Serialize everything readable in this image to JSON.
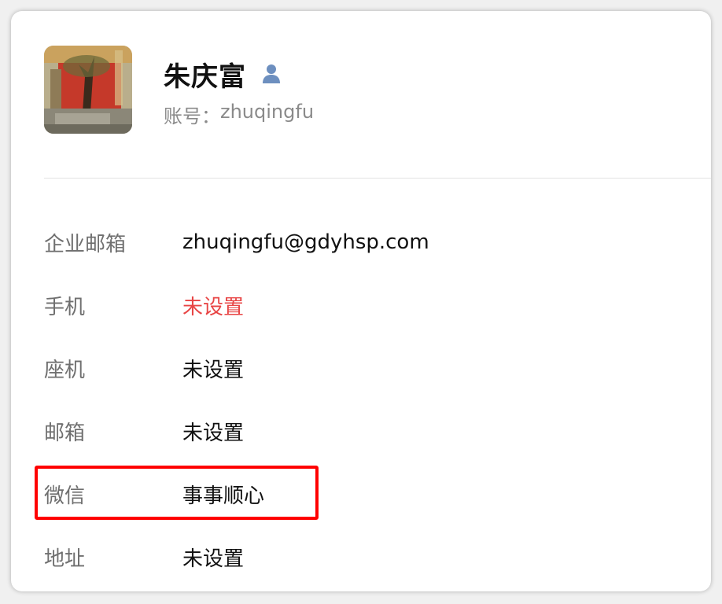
{
  "profile": {
    "name": "朱庆富",
    "account_label": "账号：",
    "account_value": "zhuqingfu",
    "avatar_icon": "avatar-photo",
    "user_icon": "person-icon"
  },
  "fields": [
    {
      "label": "企业邮箱",
      "value": "zhuqingfu@gdyhsp.com"
    },
    {
      "label": "手机",
      "value": "未设置"
    },
    {
      "label": "座机",
      "value": "未设置"
    },
    {
      "label": "邮箱",
      "value": "未设置"
    },
    {
      "label": "微信",
      "value": "事事顺心"
    },
    {
      "label": "地址",
      "value": "未设置"
    }
  ],
  "colors": {
    "unset_warning": "#e84545",
    "highlight": "#ff0000",
    "icon_blue": "#6d8fbf"
  }
}
